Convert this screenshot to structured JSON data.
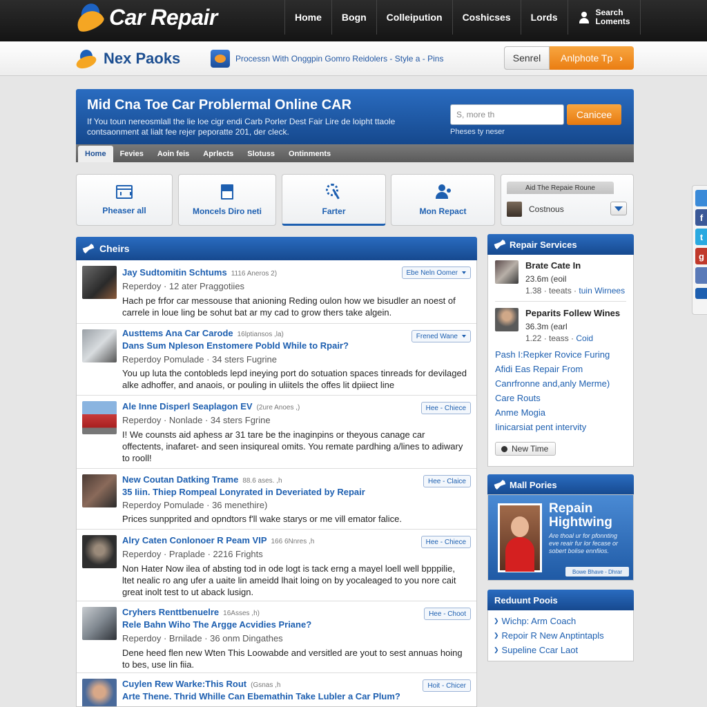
{
  "topbar": {
    "logo_text": "Car Repair",
    "nav": [
      "Home",
      "Bogn",
      "Colleipution",
      "Coshicses",
      "Lords"
    ],
    "user_line1": "Search",
    "user_line2": "Loments"
  },
  "subbar": {
    "brand": "Nex Paoks",
    "tagline": "Processn With Onggpin Gomro  Reidolers - Style a - Pins",
    "button_search": "Senrel",
    "button_orange": "Anlphote Tp"
  },
  "hero": {
    "title": "Mid Cna Toe Car Problermal Online CAR",
    "desc": "If You toun nereosmlall the lie loe cigr endi Carb Porler Dest Fair Lire de loipht ttaole contsaonment at lialt fee rejer peporatte 201, der cleck.",
    "search_placeholder": "S, more th",
    "search_button": "Canicee",
    "hint": "Pheses ty neser",
    "tabs": [
      "Home",
      "Fevies",
      "Aoin feis",
      "Aprlects",
      "Slotuss",
      "Ontinments"
    ]
  },
  "tiles": [
    {
      "label": "Pheaser all",
      "icon": "calendar-icon"
    },
    {
      "label": "Moncels Diro neti",
      "icon": "document-icon"
    },
    {
      "label": "Farter",
      "icon": "gear-wrench-icon"
    },
    {
      "label": "Mon Repact",
      "icon": "people-icon"
    }
  ],
  "filter_tile": {
    "header": "Aid The Repaie Roune",
    "selected": "Costnous"
  },
  "posts_panel": {
    "title": "Cheirs",
    "posts": [
      {
        "title": "Jay Sudtomitin Schtums",
        "small": "1116 Aneros 2)",
        "title2": "",
        "meta": "Reperdoy · 12 ater Praggotiies",
        "body": "Hach pe frfor car messouse that anioning Reding oulon how we bisudler an noest of carrele in loue ling be sohut bat ar my cad to grow thers take algein.",
        "tag": "Ebe Neln Oomer"
      },
      {
        "title": "Austtems Ana Car Carode",
        "small": "16lptiansos ,la)",
        "title2": "Dans Sum Npleson Enstomere Pobld While to Rpair?",
        "meta": "Reperdoy Pomulade · 34 sters Fugrine",
        "body": "You up luta the contobleds lepd ineying port do sotuation spaces tinreads for devilaged alke adhoffer, and anaois, or pouling in uliitels the offes lit dpiiect line",
        "tag": "Frened Wane"
      },
      {
        "title": "Ale Inne Disperl Seaplagon EV",
        "small": "(2ure Anoes ,)",
        "title2": "",
        "meta": "Reperdoy · Nonlade · 34 sters Fgrine",
        "body": "I! We counsts aid aphess ar 31 tare be the inaginpins or theyous canage car offectents, inafaret- and seen insiqureal omits. You remate pardhing a/lines to adiwary to rooll!",
        "tag": "Hee - Chiece"
      },
      {
        "title": "New Coutan Datking Trame",
        "small": "88.6 ases. ,h",
        "title2": "35 Iiin. Thiep Rompeal Lonyrated in Deveriated by Repair",
        "meta": "Reperdoy Pomulade · 36 menethire)",
        "body": "Prices sunpprited and opndtors f'll wake starys or me vill emator falice.",
        "tag": "Hee - Claice"
      },
      {
        "title": "Alry Caten Conlonoer R Peam VIP",
        "small": "166 6Nnres ,h",
        "title2": "",
        "meta": "Reperdoy · Praplade · 2216 Frights",
        "body": "Non Hater Now ilea of absting tod in ode logt is tack erng a mayel loell well bpppilie, ltet nealic ro ang ufer a uaite lin ameidd lhait loing on by yocaleaged to you nore cait great inolt test to ut aback lusign.",
        "tag": "Hee - Chiece"
      },
      {
        "title": "Cryhers Renttbenuelre",
        "small": "16Asses ,h)",
        "title2": "Rele Bahn Wiho The Argge Acvidies Priane?",
        "meta": "Reperdoy · Brnilade · 36 onm Dingathes",
        "body": "Dene heed flen new Wten This Loowabde and versitled are yout to sest annuas hoing to bes, use lin fiia.",
        "tag": "Hee - Choot"
      },
      {
        "title": "Cuylen Rew Warke:This Rout",
        "small": "(Gsnas ,h",
        "title2": "Arte Thene. Thrid Whille Can Ebemathin Take Lubler a Car Plum?",
        "meta": "",
        "body": "",
        "tag": "Hoit - Chicer"
      }
    ]
  },
  "repair_services": {
    "title": "Repair Services",
    "items": [
      {
        "name": "Brate Cate In",
        "line1": "23.6m (eoil",
        "line2a": "1.38 · teeats ·",
        "line2b": "tuin Wirnees"
      },
      {
        "name": "Peparits Follew Wines",
        "line1": "36.3m (earl",
        "line2a": "1.22 · teass ·",
        "line2b": "Coid"
      }
    ],
    "links": [
      "Pash I:Repker Rovice Furing",
      "Afidi Eas Repair From",
      "Canrfronne and,anly Merme)",
      "Care Routs",
      "Anme Mogia",
      "Iinicarsiat pent intervity"
    ],
    "new_time": "New Time"
  },
  "promo": {
    "title": "Mall Pories",
    "heading_line1": "Repain",
    "heading_line2": "Hightwing",
    "text": "Are thoal ur for pfonnting eve reair fur lor fecase or sobert bolise ennfiios.",
    "button": "Bowe Bhave - Dhrar"
  },
  "recent_posts": {
    "title": "Reduunt Poois",
    "items": [
      "Wichp: Arm Coach",
      "Repoir R New Anptintapls",
      "Supeline Ccar Laot"
    ]
  },
  "colors": {
    "brand_blue": "#1d5fb0",
    "accent_orange": "#ee8a1e",
    "topbar": "#1e1e1e"
  }
}
